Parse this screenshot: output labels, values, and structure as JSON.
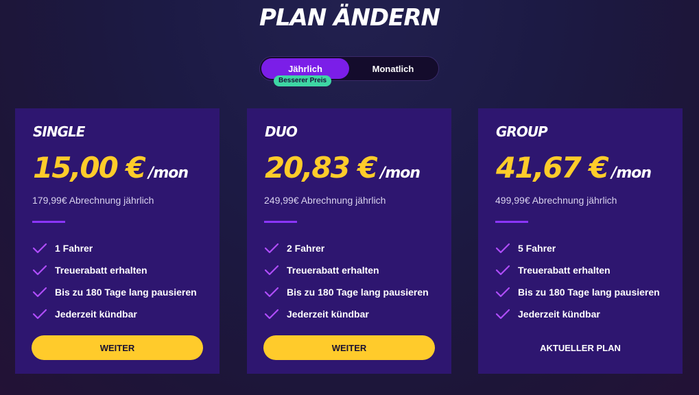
{
  "page": {
    "title": "PLAN ÄNDERN"
  },
  "billing_toggle": {
    "yearly_label": "Jährlich",
    "monthly_label": "Monatlich",
    "selected": "Jährlich",
    "badge": "Besserer Preis"
  },
  "colors": {
    "accent": "#7b1ee8",
    "price": "#ffcc2a",
    "card": "#2e1670",
    "button": "#ffcb2b",
    "badge": "#3ed6a4"
  },
  "plans": [
    {
      "name": "SINGLE",
      "price": "15,00 €",
      "period": "/mon",
      "billing": "179,99€ Abrechnung jährlich",
      "features": [
        "1 Fahrer",
        "Treuerabatt erhalten",
        "Bis zu 180 Tage lang pausieren",
        "Jederzeit kündbar"
      ],
      "action": "WEITER"
    },
    {
      "name": "DUO",
      "price": "20,83 €",
      "period": "/mon",
      "billing": "249,99€ Abrechnung jährlich",
      "features": [
        "2 Fahrer",
        "Treuerabatt erhalten",
        "Bis zu 180 Tage lang pausieren",
        "Jederzeit kündbar"
      ],
      "action": "WEITER"
    },
    {
      "name": "GROUP",
      "price": "41,67 €",
      "period": "/mon",
      "billing": "499,99€ Abrechnung jährlich",
      "features": [
        "5 Fahrer",
        "Treuerabatt erhalten",
        "Bis zu 180 Tage lang pausieren",
        "Jederzeit kündbar"
      ],
      "action": "AKTUELLER PLAN"
    }
  ]
}
